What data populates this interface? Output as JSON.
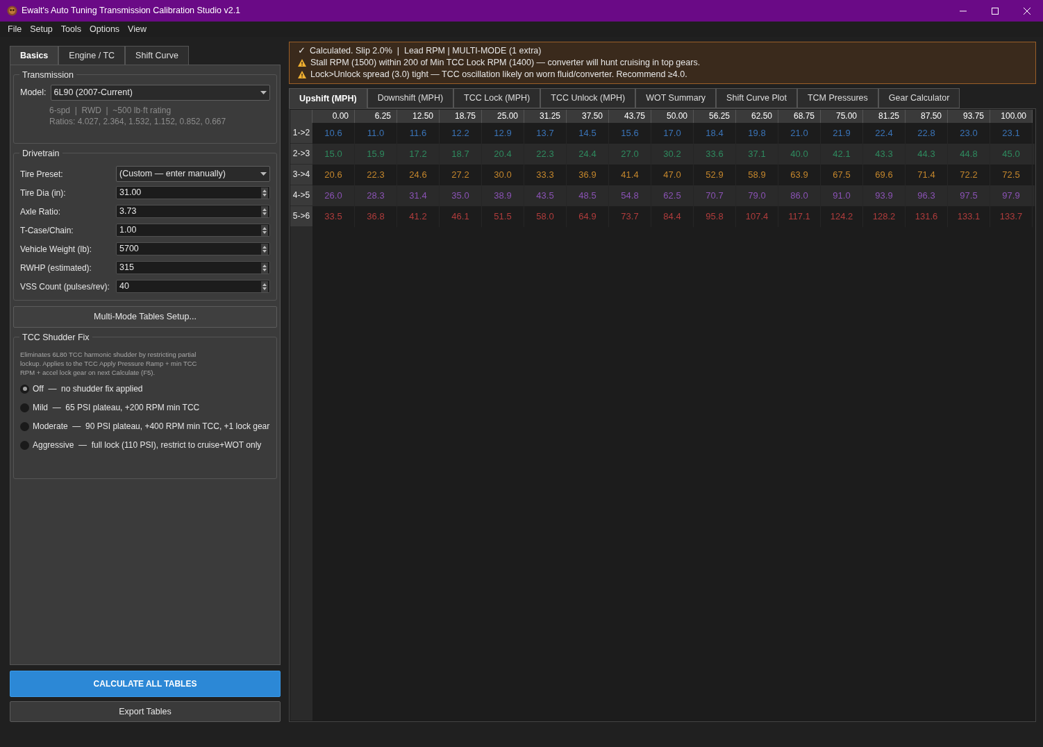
{
  "window": {
    "title": "Ewalt's Auto Tuning Transmission Calibration Studio v2.1"
  },
  "menu": [
    "File",
    "Setup",
    "Tools",
    "Options",
    "View"
  ],
  "left_tabs": [
    {
      "label": "Basics",
      "selected": true
    },
    {
      "label": "Engine / TC",
      "selected": false
    },
    {
      "label": "Shift Curve",
      "selected": false
    }
  ],
  "transmission": {
    "title": "Transmission",
    "model_label": "Model:",
    "model_value": "6L90 (2007-Current)",
    "info": [
      "6-spd  |  RWD  |  ~500 lb·ft rating",
      "Ratios: 4.027, 2.364, 1.532, 1.152, 0.852, 0.667"
    ]
  },
  "drivetrain": {
    "title": "Drivetrain",
    "fields": [
      {
        "kind": "dropdown",
        "label": "Tire Preset:",
        "value": "(Custom — enter manually)"
      },
      {
        "kind": "spin",
        "label": "Tire Dia (in):",
        "value": "31.00"
      },
      {
        "kind": "spin",
        "label": "Axle Ratio:",
        "value": "3.73"
      },
      {
        "kind": "spin",
        "label": "T-Case/Chain:",
        "value": "1.00"
      },
      {
        "kind": "spin",
        "label": "Vehicle Weight (lb):",
        "value": "5700"
      },
      {
        "kind": "spin",
        "label": "RWHP (estimated):",
        "value": "315"
      },
      {
        "kind": "spin",
        "label": "VSS Count (pulses/rev):",
        "value": "40"
      }
    ]
  },
  "multi_mode_button": "Multi-Mode Tables Setup...",
  "shudder_fix": {
    "title": "TCC Shudder Fix",
    "description": "Eliminates 6L80 TCC harmonic shudder by restricting partial lockup. Applies to the TCC Apply Pressure Ramp + min TCC RPM + accel lock gear on next Calculate (F5).",
    "options": [
      {
        "label": "Off  —  no shudder fix applied",
        "selected": true
      },
      {
        "label": "Mild  —  65 PSI plateau, +200 RPM min TCC",
        "selected": false
      },
      {
        "label": "Moderate  —  90 PSI plateau, +400 RPM min TCC, +1 lock gear",
        "selected": false
      },
      {
        "label": "Aggressive  —  full lock (110 PSI), restrict to cruise+WOT only",
        "selected": false
      }
    ]
  },
  "calculate_button": "CALCULATE ALL TABLES",
  "export_button": "Export Tables",
  "status_messages": [
    {
      "kind": "ok",
      "text": "Calculated. Slip 2.0%  |  Lead RPM | MULTI-MODE (1 extra)"
    },
    {
      "kind": "warning",
      "text": "Stall RPM (1500) within 200 of Min TCC Lock RPM (1400) — converter will hunt cruising in top gears."
    },
    {
      "kind": "warning",
      "text": "Lock>Unlock spread (3.0) tight — TCC oscillation likely on worn fluid/converter. Recommend ≥4.0."
    }
  ],
  "status_icons": {
    "ok": "✓"
  },
  "right_tabs": [
    {
      "label": "Upshift (MPH)",
      "selected": true
    },
    {
      "label": "Downshift (MPH)",
      "selected": false
    },
    {
      "label": "TCC Lock (MPH)",
      "selected": false
    },
    {
      "label": "TCC Unlock (MPH)",
      "selected": false
    },
    {
      "label": "WOT Summary",
      "selected": false
    },
    {
      "label": "Shift Curve Plot",
      "selected": false
    },
    {
      "label": "TCM Pressures",
      "selected": false
    },
    {
      "label": "Gear Calculator",
      "selected": false
    }
  ],
  "table": {
    "columns": [
      "0.00",
      "6.25",
      "12.50",
      "18.75",
      "25.00",
      "31.25",
      "37.50",
      "43.75",
      "50.00",
      "56.25",
      "62.50",
      "68.75",
      "75.00",
      "81.25",
      "87.50",
      "93.75",
      "100.00"
    ],
    "rows": [
      {
        "label": "1->2",
        "color": "#3a74b8",
        "values": [
          "10.6",
          "11.0",
          "11.6",
          "12.2",
          "12.9",
          "13.7",
          "14.5",
          "15.6",
          "17.0",
          "18.4",
          "19.8",
          "21.0",
          "21.9",
          "22.4",
          "22.8",
          "23.0",
          "23.1"
        ]
      },
      {
        "label": "2->3",
        "color": "#2e8a5e",
        "values": [
          "15.0",
          "15.9",
          "17.2",
          "18.7",
          "20.4",
          "22.3",
          "24.4",
          "27.0",
          "30.2",
          "33.6",
          "37.1",
          "40.0",
          "42.1",
          "43.3",
          "44.3",
          "44.8",
          "45.0"
        ]
      },
      {
        "label": "3->4",
        "color": "#c4862c",
        "values": [
          "20.6",
          "22.3",
          "24.6",
          "27.2",
          "30.0",
          "33.3",
          "36.9",
          "41.4",
          "47.0",
          "52.9",
          "58.9",
          "63.9",
          "67.5",
          "69.6",
          "71.4",
          "72.2",
          "72.5"
        ]
      },
      {
        "label": "4->5",
        "color": "#8a52b4",
        "values": [
          "26.0",
          "28.3",
          "31.4",
          "35.0",
          "38.9",
          "43.5",
          "48.5",
          "54.8",
          "62.5",
          "70.7",
          "79.0",
          "86.0",
          "91.0",
          "93.9",
          "96.3",
          "97.5",
          "97.9"
        ]
      },
      {
        "label": "5->6",
        "color": "#b03c3c",
        "values": [
          "33.5",
          "36.8",
          "41.2",
          "46.1",
          "51.5",
          "58.0",
          "64.9",
          "73.7",
          "84.4",
          "95.8",
          "107.4",
          "117.1",
          "124.2",
          "128.2",
          "131.6",
          "133.1",
          "133.7"
        ]
      }
    ]
  }
}
